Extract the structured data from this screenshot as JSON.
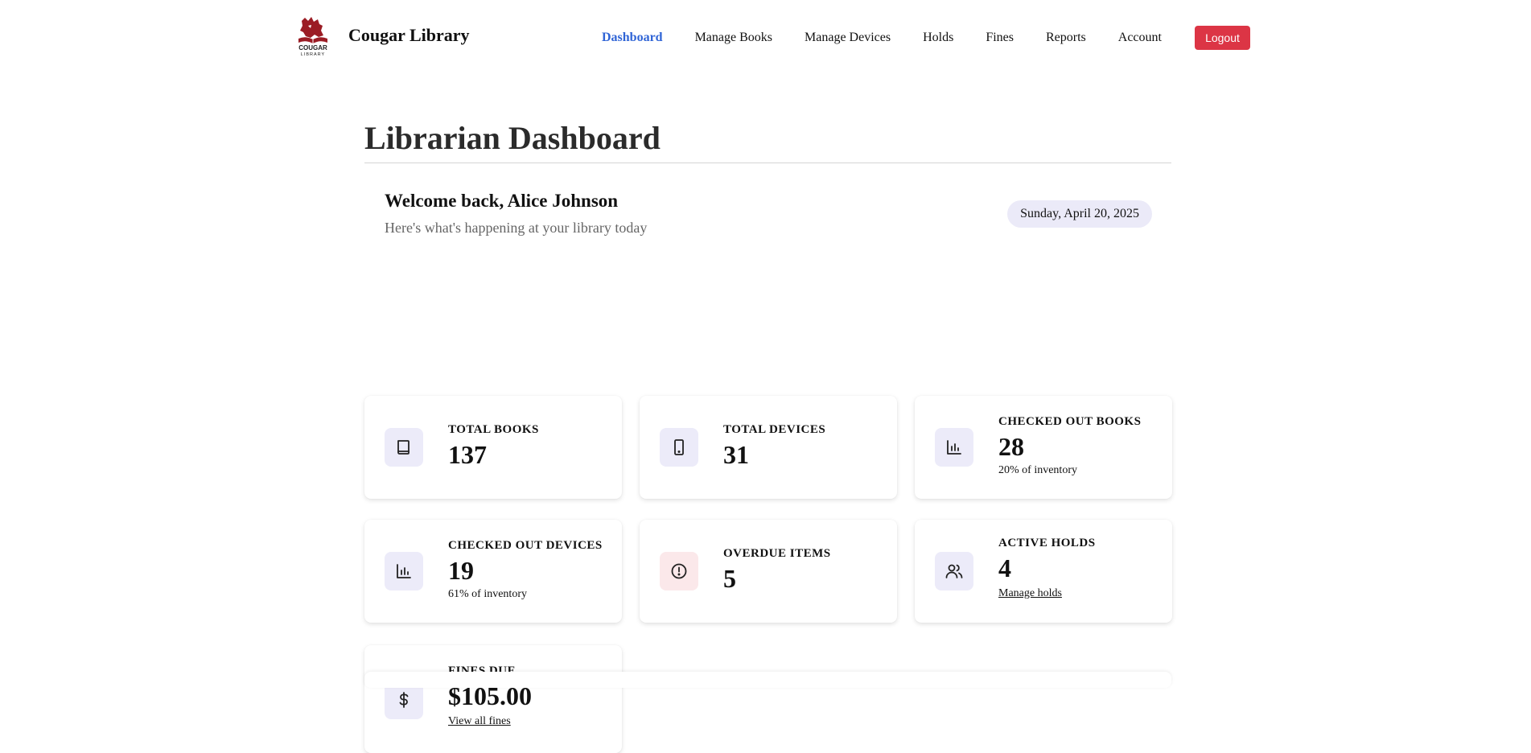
{
  "brand": {
    "name": "Cougar Library",
    "logo_text": "COUGAR LIBRARY",
    "logo_color": "#9b1c24"
  },
  "nav": {
    "items": [
      {
        "label": "Dashboard",
        "active": true
      },
      {
        "label": "Manage Books"
      },
      {
        "label": "Manage Devices"
      },
      {
        "label": "Holds"
      },
      {
        "label": "Fines"
      },
      {
        "label": "Reports"
      },
      {
        "label": "Account"
      }
    ],
    "logout_label": "Logout",
    "active_color": "#2f64d6",
    "logout_color": "#dc3545"
  },
  "page": {
    "title": "Librarian Dashboard"
  },
  "welcome": {
    "title": "Welcome back, Alice Johnson",
    "subtitle": "Here's what's happening at your library today",
    "date": "Sunday, April 20, 2025"
  },
  "cards": {
    "total_books": {
      "label": "TOTAL BOOKS",
      "value": "137",
      "icon": "book-icon"
    },
    "total_devices": {
      "label": "TOTAL DEVICES",
      "value": "31",
      "icon": "tablet-icon"
    },
    "checked_out_books": {
      "label": "CHECKED OUT BOOKS",
      "value": "28",
      "note": "20% of inventory",
      "icon": "bar-chart-icon"
    },
    "checked_out_devices": {
      "label": "CHECKED OUT DEVICES",
      "value": "19",
      "note": "61% of inventory",
      "icon": "bar-chart-icon"
    },
    "overdue_items": {
      "label": "OVERDUE ITEMS",
      "value": "5",
      "icon": "alert-clock-icon"
    },
    "active_holds": {
      "label": "ACTIVE HOLDS",
      "value": "4",
      "link": "Manage holds",
      "icon": "users-icon"
    },
    "fines_due": {
      "label": "FINES DUE",
      "value": "$105.00",
      "link": "View all fines",
      "icon": "dollar-icon"
    }
  }
}
